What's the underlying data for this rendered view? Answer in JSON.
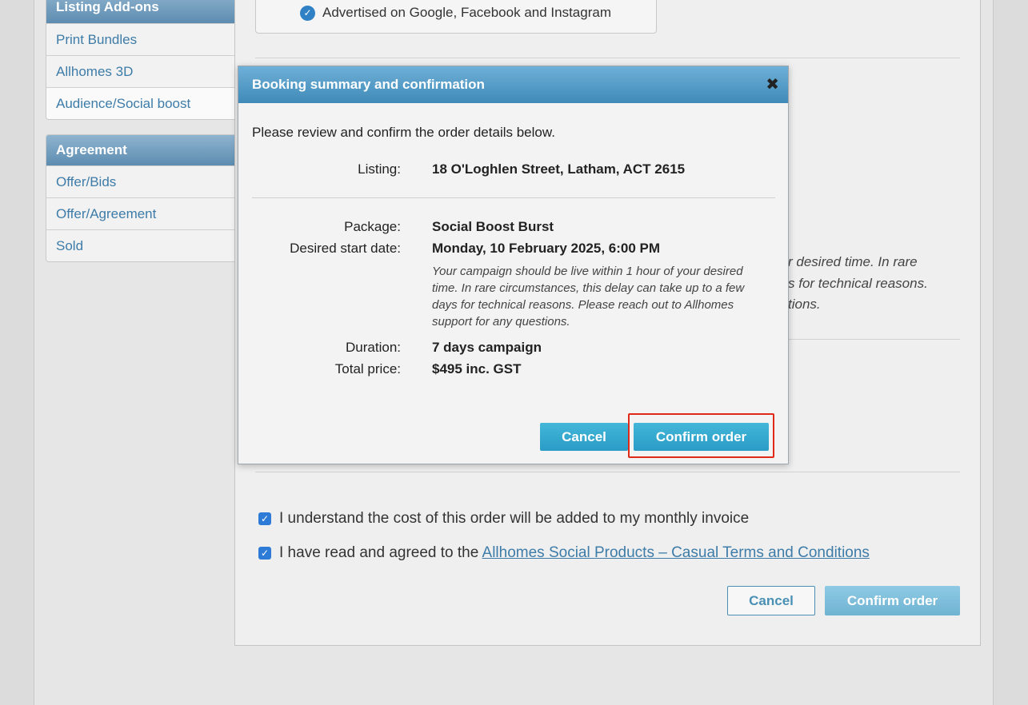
{
  "sidebar": {
    "addons_title": "Listing Add-ons",
    "addons_items": [
      "Print Bundles",
      "Allhomes 3D",
      "Audience/Social boost"
    ],
    "agreement_title": "Agreement",
    "agreement_items": [
      "Offer/Bids",
      "Offer/Agreement",
      "Sold"
    ]
  },
  "main": {
    "feature_text": "Advertised on Google, Facebook and Instagram",
    "bg_note_line1": "r desired time. In rare",
    "bg_note_line2": "s for technical reasons.",
    "bg_note_line3": "tions.",
    "agree_invoice": "I understand the cost of this order will be added to my monthly invoice",
    "agree_terms_prefix": "I have read and agreed to the ",
    "agree_terms_link": "Allhomes Social Products – Casual Terms and Conditions",
    "cancel_label": "Cancel",
    "confirm_label": "Confirm order"
  },
  "modal": {
    "title": "Booking summary and confirmation",
    "close_glyph": "✖",
    "intro": "Please review and confirm the order details below.",
    "listing_label": "Listing:",
    "listing_value": "18 O'Loghlen Street, Latham, ACT 2615",
    "package_label": "Package:",
    "package_value": "Social Boost Burst",
    "start_label": "Desired start date:",
    "start_value": "Monday, 10 February 2025, 6:00 PM",
    "start_note": "Your campaign should be live within 1 hour of your desired time. In rare circumstances, this delay can take up to a few days for technical reasons. Please reach out to Allhomes support for any questions.",
    "duration_label": "Duration:",
    "duration_value": "7 days campaign",
    "price_label": "Total price:",
    "price_value": "$495 inc. GST",
    "cancel_label": "Cancel",
    "confirm_label": "Confirm order"
  },
  "colors": {
    "header_blue": "#3f8ab8",
    "button_blue": "#2a9cc6",
    "link_blue": "#3d7ca8",
    "highlight_red": "#e02a17"
  }
}
